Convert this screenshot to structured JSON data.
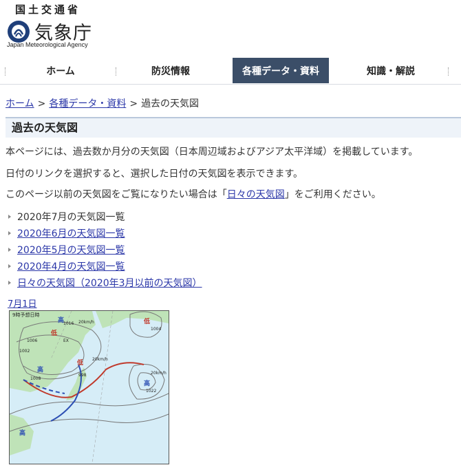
{
  "header": {
    "ministry": "国土交通省",
    "agency": "気象庁",
    "agency_en": "Japan Meteorological Agency"
  },
  "nav": {
    "items": [
      {
        "label": "ホーム"
      },
      {
        "label": "防災情報"
      },
      {
        "label": "各種データ・資料",
        "active": true
      },
      {
        "label": "知識・解説"
      }
    ]
  },
  "breadcrumb": {
    "home": "ホーム",
    "sep": ">",
    "data": "各種データ・資料",
    "current": "過去の天気図"
  },
  "page": {
    "title": "過去の天気図",
    "para1": "本ページには、過去数か月分の天気図（日本周辺域およびアジア太平洋域）を掲載しています。",
    "para2": "日付のリンクを選択すると、選択した日付の天気図を表示できます。",
    "para3_before": "このページ以前の天気図をご覧になりたい場合は「",
    "para3_link": "日々の天気図",
    "para3_after": "」をご利用ください。"
  },
  "links": [
    {
      "label": "2020年7月の天気図一覧",
      "is_link": false
    },
    {
      "label": "2020年6月の天気図一覧",
      "is_link": true
    },
    {
      "label": "2020年5月の天気図一覧",
      "is_link": true
    },
    {
      "label": "2020年4月の天気図一覧",
      "is_link": true
    },
    {
      "label": "日々の天気図（2020年3月以前の天気図）",
      "is_link": true
    }
  ],
  "date_link": "7月1日",
  "map": {
    "stamp": "9時予想日時",
    "labels": {
      "high": "高",
      "low": "低",
      "low2": "低",
      "low3": "低",
      "high2": "高",
      "high3": "高",
      "high4": "高",
      "p1016": "1016",
      "p1006": "1006",
      "p1002": "1002",
      "p1008": "1008",
      "p998": "998",
      "p1022": "1022",
      "p1004": "1004",
      "w1": "20km/h",
      "w2": "20km/h",
      "w3": "20km/h",
      "ex": "EX"
    }
  }
}
